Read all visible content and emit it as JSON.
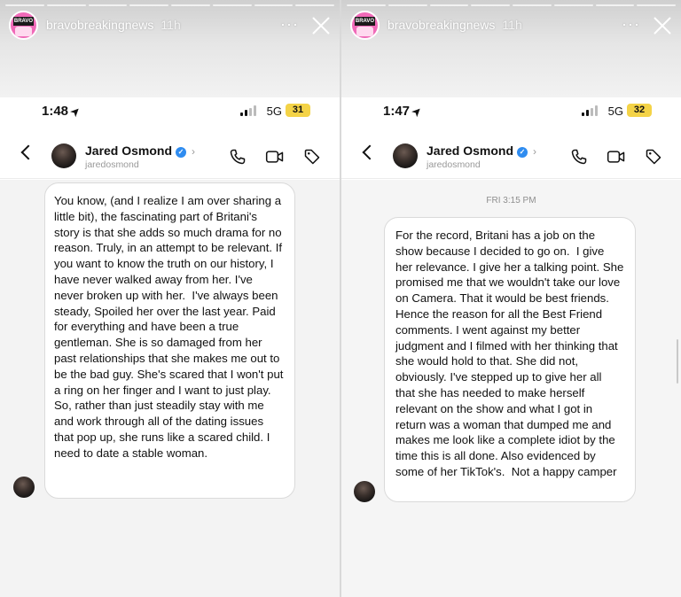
{
  "story": {
    "username": "bravobreakingnews",
    "time_ago": "11h",
    "avatar_text": "BRAVO",
    "more_label": "···"
  },
  "panels": [
    {
      "status": {
        "time": "1:48",
        "network": "5G",
        "battery": "31"
      },
      "chat": {
        "name": "Jared Osmond",
        "handle": "jaredosmond",
        "date_label": "",
        "message": "You know, (and I realize I am over sharing a little bit), the fascinating part of Britani's story is that she adds so much drama for no reason. Truly, in an attempt to be relevant. If you want to know the truth on our history, I have never walked away from her. I've never broken up with her.  I've always been steady, Spoiled her over the last year. Paid for everything and have been a true gentleman. She is so damaged from her past relationships that she makes me out to be the bad guy. She's scared that I won't put a ring on her finger and I want to just play.  So, rather than just steadily stay with me and work through all of the dating issues that pop up, she runs like a scared child. I need to date a stable woman."
      }
    },
    {
      "status": {
        "time": "1:47",
        "network": "5G",
        "battery": "32"
      },
      "chat": {
        "name": "Jared Osmond",
        "handle": "jaredosmond",
        "date_label": "FRI 3:15 PM",
        "message": "For the record, Britani has a job on the show because I decided to go on.  I give her relevance. I give her a talking point. She promised me that we wouldn't take our love on Camera. That it would be best friends. Hence the reason for all the Best Friend comments. I went against my better judgment and I filmed with her thinking that she would hold to that. She did not, obviously. I've stepped up to give her all that she has needed to make herself relevant on the show and what I got in return was a woman that dumped me and makes me look like a complete idiot by the time this is all done. Also evidenced by some of her TikTok's.  Not a happy camper"
      }
    }
  ],
  "colors": {
    "story_pink": "#f06ab8",
    "verified_blue": "#2f8cf0",
    "battery_yellow": "#f4d347"
  },
  "icons": [
    "back-chevron-icon",
    "verified-badge-icon",
    "phone-icon",
    "video-camera-icon",
    "tag-icon",
    "close-icon",
    "more-icon",
    "location-arrow-icon"
  ]
}
